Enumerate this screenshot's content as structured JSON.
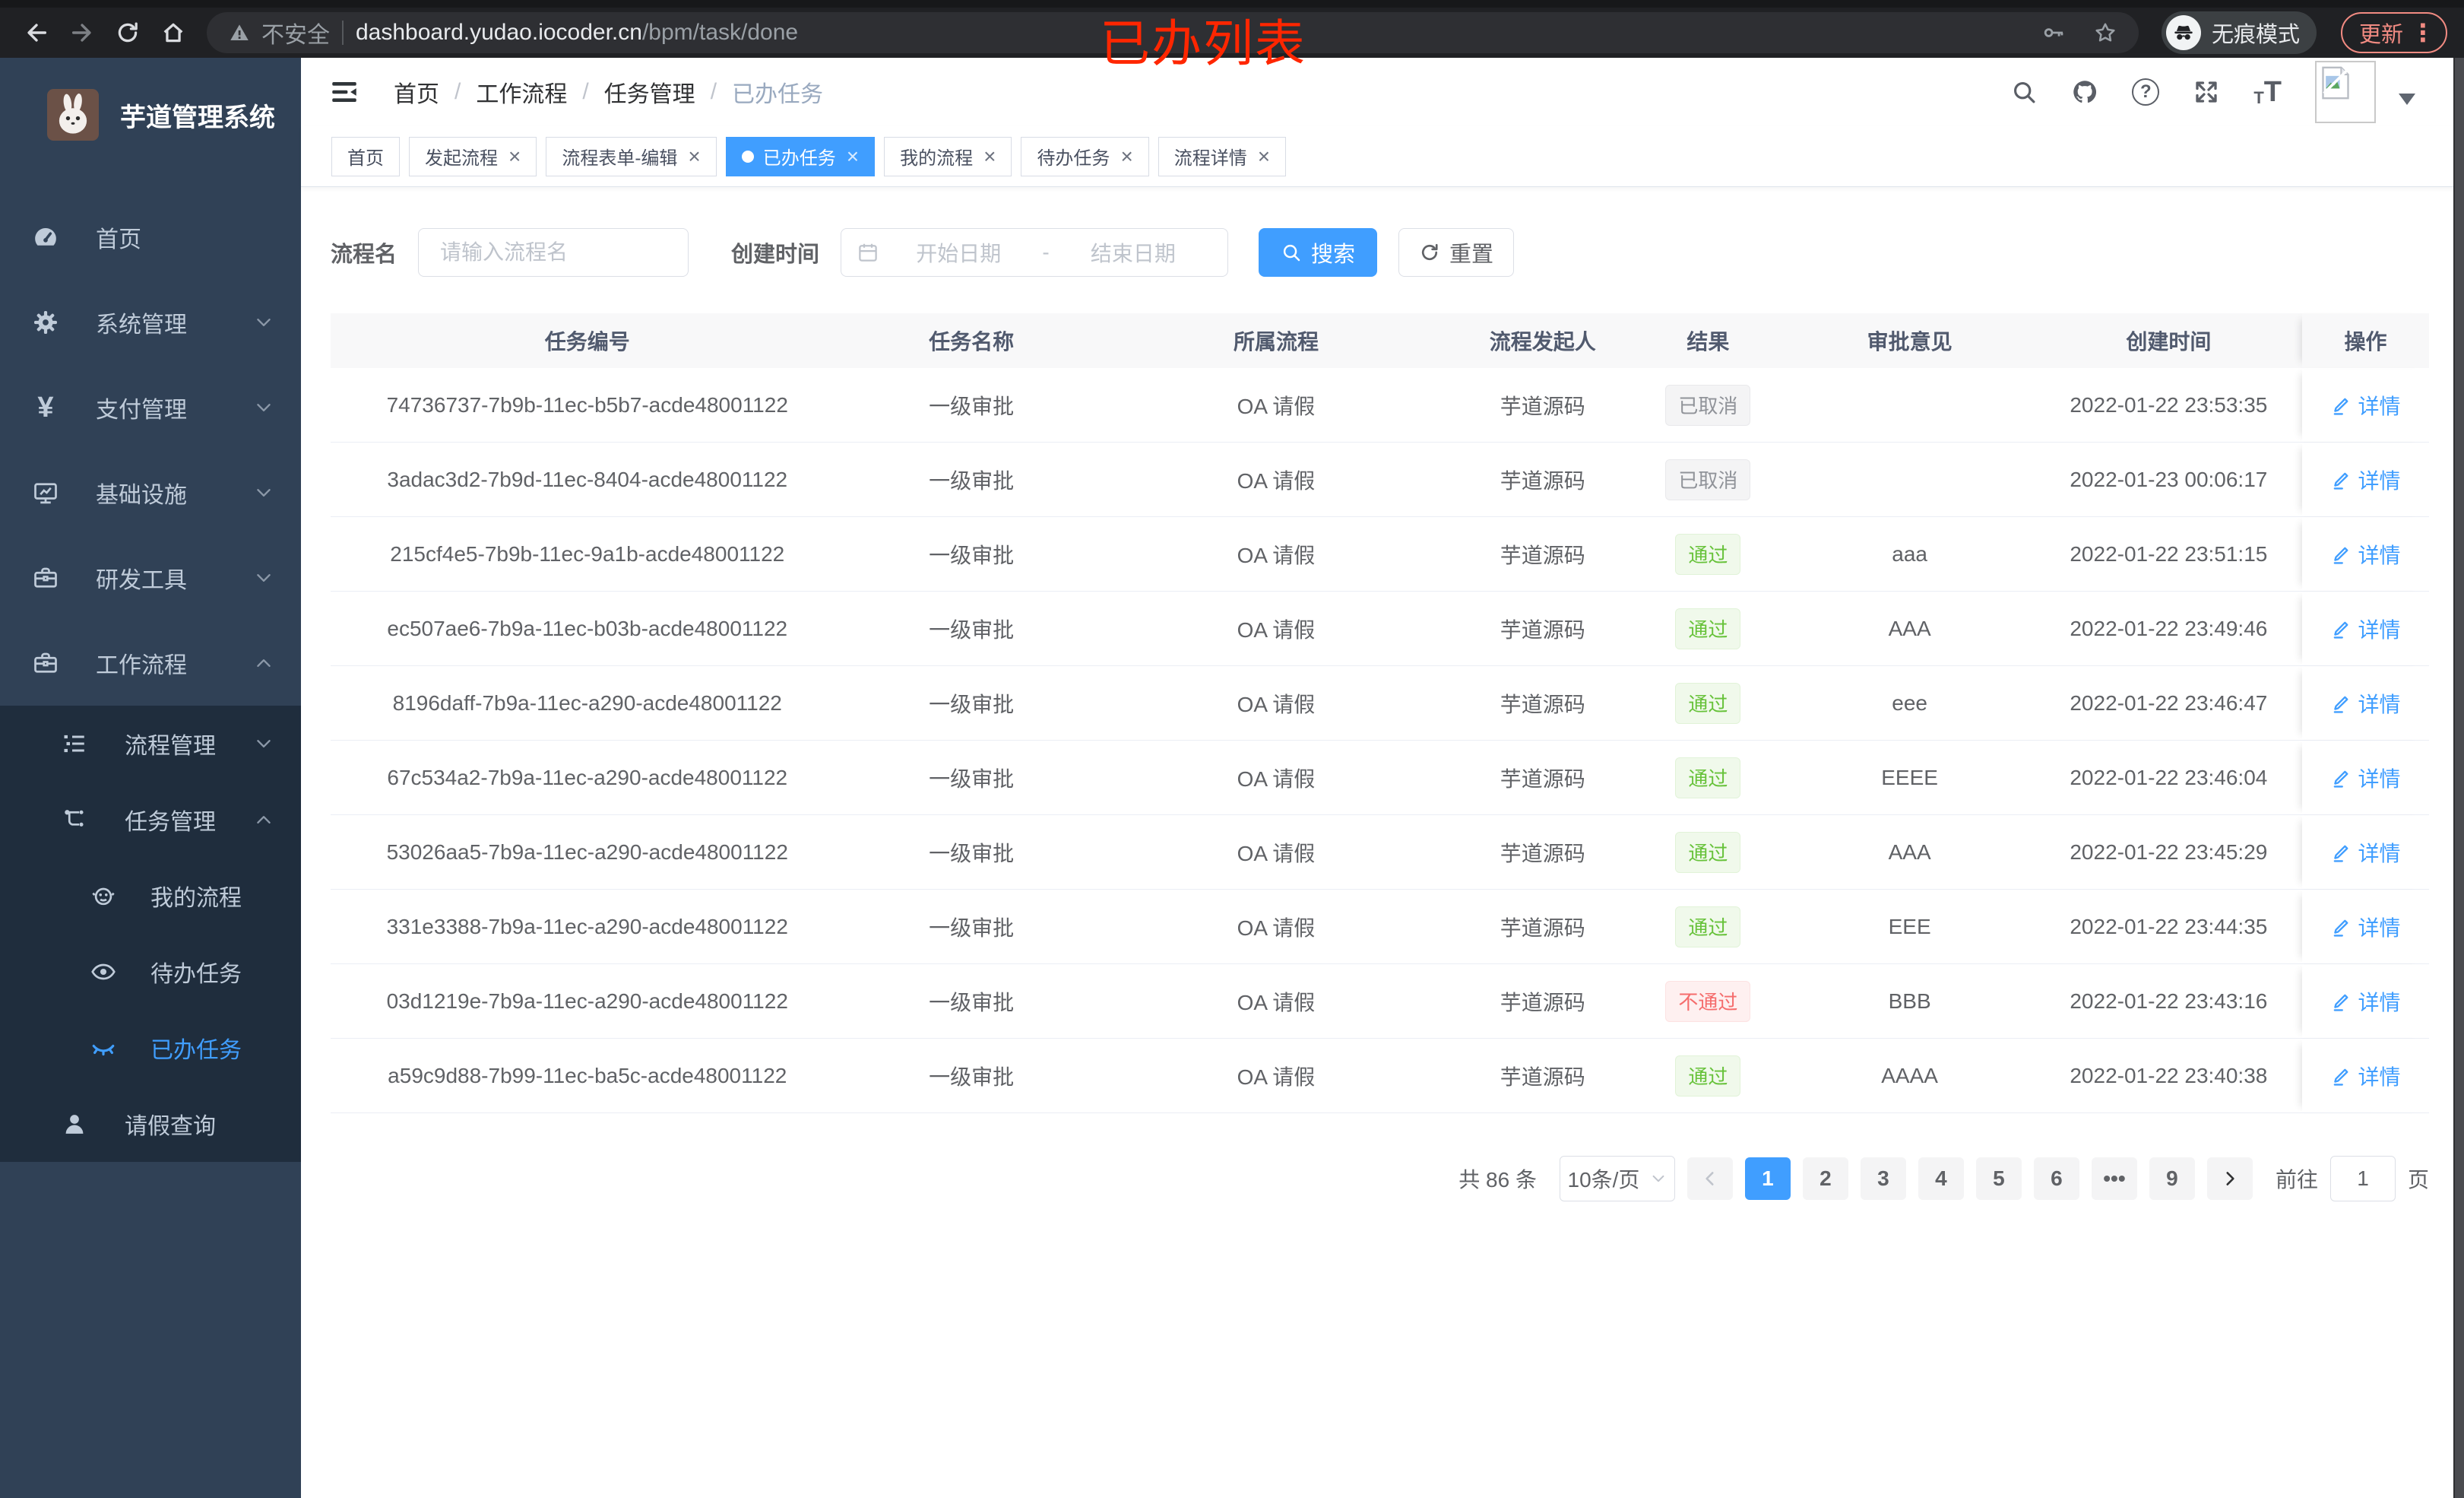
{
  "browser": {
    "security_label": "不安全",
    "url_domain": "dashboard.yudao.iocoder.cn",
    "url_path": "/bpm/task/done",
    "incognito_label": "无痕模式",
    "update_label": "更新",
    "menu_dots": "⋮"
  },
  "annotation": {
    "text": "已办列表",
    "color": "#ff2600"
  },
  "sidebar": {
    "title": "芋道管理系统",
    "home": "首页",
    "system": "系统管理",
    "pay": "支付管理",
    "infra": "基础设施",
    "devtool": "研发工具",
    "workflow": "工作流程",
    "process_mgmt": "流程管理",
    "task_mgmt": "任务管理",
    "my_process": "我的流程",
    "todo": "待办任务",
    "done": "已办任务",
    "leave_query": "请假查询",
    "yen_icon": "¥"
  },
  "header": {
    "breadcrumb": [
      "首页",
      "工作流程",
      "任务管理",
      "已办任务"
    ],
    "icons": [
      "search-icon",
      "github-icon",
      "help-icon",
      "fullscreen-icon",
      "font-size-icon",
      "avatar-placeholder",
      "caret-down"
    ]
  },
  "tabs": [
    {
      "label": "首页"
    },
    {
      "label": "发起流程",
      "close": "×"
    },
    {
      "label": "流程表单-编辑",
      "close": "×"
    },
    {
      "label": "已办任务",
      "close": "×",
      "active": true
    },
    {
      "label": "我的流程",
      "close": "×"
    },
    {
      "label": "待办任务",
      "close": "×"
    },
    {
      "label": "流程详情",
      "close": "×"
    }
  ],
  "filters": {
    "name_label": "流程名",
    "name_placeholder": "请输入流程名",
    "time_label": "创建时间",
    "start_placeholder": "开始日期",
    "range_separator": "-",
    "end_placeholder": "结束日期",
    "search_label": "搜索",
    "reset_label": "重置"
  },
  "table": {
    "columns": [
      "任务编号",
      "任务名称",
      "所属流程",
      "流程发起人",
      "结果",
      "审批意见",
      "创建时间",
      "操作"
    ],
    "detail_label": "详情",
    "rows": [
      {
        "id": "74736737-7b9b-11ec-b5b7-acde48001122",
        "name": "一级审批",
        "process": "OA 请假",
        "starter": "芋道源码",
        "result": "已取消",
        "result_type": "info",
        "comment": "",
        "created": "2022-01-22 23:53:35"
      },
      {
        "id": "3adac3d2-7b9d-11ec-8404-acde48001122",
        "name": "一级审批",
        "process": "OA 请假",
        "starter": "芋道源码",
        "result": "已取消",
        "result_type": "info",
        "comment": "",
        "created": "2022-01-23 00:06:17"
      },
      {
        "id": "215cf4e5-7b9b-11ec-9a1b-acde48001122",
        "name": "一级审批",
        "process": "OA 请假",
        "starter": "芋道源码",
        "result": "通过",
        "result_type": "success",
        "comment": "aaa",
        "created": "2022-01-22 23:51:15"
      },
      {
        "id": "ec507ae6-7b9a-11ec-b03b-acde48001122",
        "name": "一级审批",
        "process": "OA 请假",
        "starter": "芋道源码",
        "result": "通过",
        "result_type": "success",
        "comment": "AAA",
        "created": "2022-01-22 23:49:46"
      },
      {
        "id": "8196daff-7b9a-11ec-a290-acde48001122",
        "name": "一级审批",
        "process": "OA 请假",
        "starter": "芋道源码",
        "result": "通过",
        "result_type": "success",
        "comment": "eee",
        "created": "2022-01-22 23:46:47"
      },
      {
        "id": "67c534a2-7b9a-11ec-a290-acde48001122",
        "name": "一级审批",
        "process": "OA 请假",
        "starter": "芋道源码",
        "result": "通过",
        "result_type": "success",
        "comment": "EEEE",
        "created": "2022-01-22 23:46:04"
      },
      {
        "id": "53026aa5-7b9a-11ec-a290-acde48001122",
        "name": "一级审批",
        "process": "OA 请假",
        "starter": "芋道源码",
        "result": "通过",
        "result_type": "success",
        "comment": "AAA",
        "created": "2022-01-22 23:45:29"
      },
      {
        "id": "331e3388-7b9a-11ec-a290-acde48001122",
        "name": "一级审批",
        "process": "OA 请假",
        "starter": "芋道源码",
        "result": "通过",
        "result_type": "success",
        "comment": "EEE",
        "created": "2022-01-22 23:44:35"
      },
      {
        "id": "03d1219e-7b9a-11ec-a290-acde48001122",
        "name": "一级审批",
        "process": "OA 请假",
        "starter": "芋道源码",
        "result": "不通过",
        "result_type": "danger",
        "comment": "BBB",
        "created": "2022-01-22 23:43:16"
      },
      {
        "id": "a59c9d88-7b99-11ec-ba5c-acde48001122",
        "name": "一级审批",
        "process": "OA 请假",
        "starter": "芋道源码",
        "result": "通过",
        "result_type": "success",
        "comment": "AAAA",
        "created": "2022-01-22 23:40:38"
      }
    ]
  },
  "pagination": {
    "total": "共 86 条",
    "page_size": "10条/页",
    "pages": [
      "1",
      "2",
      "3",
      "4",
      "5",
      "6"
    ],
    "ellipsis": "•••",
    "last_page": "9",
    "goto_label": "前往",
    "goto_value": "1",
    "page_unit": "页"
  },
  "colors": {
    "accent": "#409eff",
    "success": "#67c23a",
    "danger": "#f56c6c",
    "info": "#909399",
    "update_badge": "#f28b82",
    "annotation": "#ff2600",
    "sidebar_bg": "#304156",
    "submenu_bg": "#1f2d3d"
  }
}
